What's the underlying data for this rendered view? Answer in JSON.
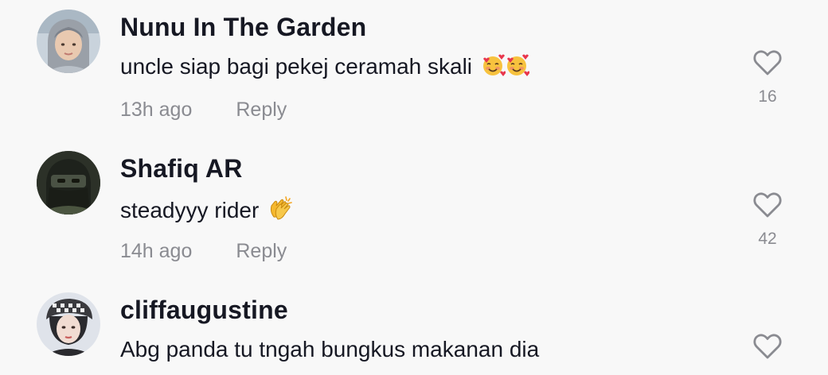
{
  "comments": [
    {
      "username": "Nunu In The Garden",
      "text": "uncle siap bagi pekej ceramah skali",
      "emojis": [
        "smiling-face-with-hearts",
        "smiling-face-with-hearts"
      ],
      "time": "13h ago",
      "reply_label": "Reply",
      "likes": "16"
    },
    {
      "username": "Shafiq AR",
      "text": "steadyyy rider",
      "emojis": [
        "clapping-hands"
      ],
      "time": "14h ago",
      "reply_label": "Reply",
      "likes": "42"
    },
    {
      "username": "cliffaugustine",
      "text": "Abg panda tu tngah bungkus makanan dia",
      "emojis": [],
      "time": "",
      "reply_label": "",
      "likes": ""
    }
  ],
  "colors": {
    "background": "#f8f8f8",
    "primary_text": "#161823",
    "secondary_text": "#8a8b91",
    "heart_outline": "#8a8b91"
  }
}
